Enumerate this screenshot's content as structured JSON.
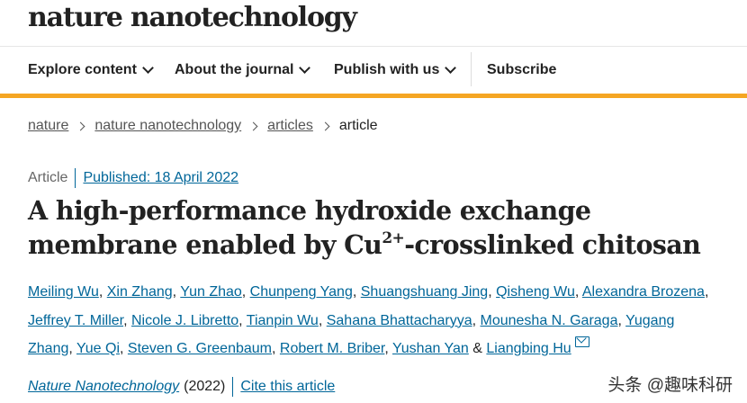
{
  "brand": {
    "name": "nature nanotechnology"
  },
  "nav": {
    "items": [
      "Explore content",
      "About the journal",
      "Publish with us"
    ],
    "subscribe": "Subscribe"
  },
  "breadcrumb": [
    "nature",
    "nature nanotechnology",
    "articles",
    "article"
  ],
  "article": {
    "type": "Article",
    "published": "Published: 18 April 2022",
    "title_part1": "A high-performance hydroxide exchange membrane enabled by Cu",
    "title_sup": "2+",
    "title_part2": "-crosslinked chitosan",
    "authors": [
      "Meiling Wu",
      "Xin Zhang",
      "Yun Zhao",
      "Chunpeng Yang",
      "Shuangshuang Jing",
      "Qisheng Wu",
      "Alexandra Brozena",
      "Jeffrey T. Miller",
      "Nicole J. Libretto",
      "Tianpin Wu",
      "Sahana Bhattacharyya",
      "Mounesha N. Garaga",
      "Yugang Zhang",
      "Yue Qi",
      "Steven G. Greenbaum",
      "Robert M. Briber",
      "Yushan Yan",
      "Liangbing Hu"
    ],
    "author_sep": ", ",
    "author_last_sep": " & ",
    "journal": "Nature Nanotechnology",
    "year": "(2022)",
    "cite": "Cite this article"
  },
  "accent_color": "#f5a623",
  "link_color": "#006699",
  "watermark": "头条 @趣味科研"
}
